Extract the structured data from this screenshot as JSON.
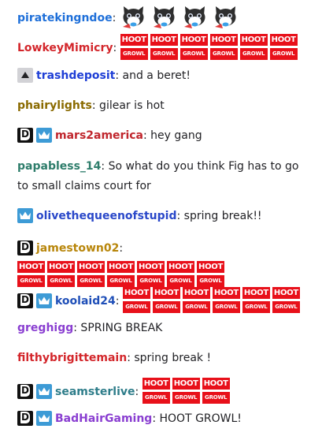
{
  "messages": [
    {
      "user": "piratekingndoe",
      "color": "#1e6fd9",
      "badges": [],
      "text": "",
      "emotes": {
        "type": "cat",
        "count": 4
      }
    },
    {
      "user": "LowkeyMimicry",
      "color": "#d3262b",
      "badges": [],
      "text": "",
      "emotes": {
        "type": "hoot",
        "count": 6
      }
    },
    {
      "user": "trashdeposit",
      "color": "#1f3fd6",
      "badges": [
        "triangle-badge"
      ],
      "text": ": and a beret!",
      "emotes": null
    },
    {
      "user": "phairylights",
      "color": "#8a6a00",
      "badges": [],
      "text": ": gilear is hot",
      "emotes": null
    },
    {
      "user": "mars2america",
      "color": "#c0262d",
      "badges": [
        "d-badge",
        "crown-badge"
      ],
      "text": ": hey gang",
      "emotes": null
    },
    {
      "user": "papabless_14",
      "color": "#2e7d6b",
      "badges": [],
      "text": ": So what do you think Fig has to go to small claims court for",
      "emotes": null
    },
    {
      "user": "olivethequeenofstupid",
      "color": "#2a48c9",
      "badges": [
        "crown-badge"
      ],
      "text": ": spring break!!",
      "emotes": null
    },
    {
      "user": "jamestown02",
      "color": "#b8860b",
      "badges": [
        "d-badge"
      ],
      "text": "",
      "emotes": {
        "type": "hoot",
        "count": 7
      }
    },
    {
      "user": "koolaid24",
      "color": "#1f4fb8",
      "badges": [
        "d-badge",
        "crown-badge"
      ],
      "text": "",
      "emotes": {
        "type": "hoot",
        "count": 6
      }
    },
    {
      "user": "greghigg",
      "color": "#8a3fd1",
      "badges": [],
      "text": ": SPRING BREAK",
      "emotes": null
    },
    {
      "user": "filthybrigittemain",
      "color": "#d3262b",
      "badges": [],
      "text": ": spring break !",
      "emotes": null
    },
    {
      "user": "seamsterlive",
      "color": "#2e7d8a",
      "badges": [
        "d-badge",
        "crown-badge"
      ],
      "text": "",
      "emotes": {
        "type": "hoot",
        "count": 3
      }
    },
    {
      "user": "BadHairGaming",
      "color": "#8a3fd1",
      "badges": [
        "d-badge",
        "crown-badge"
      ],
      "text": ": HOOT GROWL!",
      "emotes": null
    }
  ],
  "emote_text": {
    "top": "HOOT",
    "bottom": "GROWL"
  },
  "colors": {
    "hoot_red": "#e8101a",
    "crown_blue": "#3d9bd6",
    "text": "#1f1f23"
  }
}
